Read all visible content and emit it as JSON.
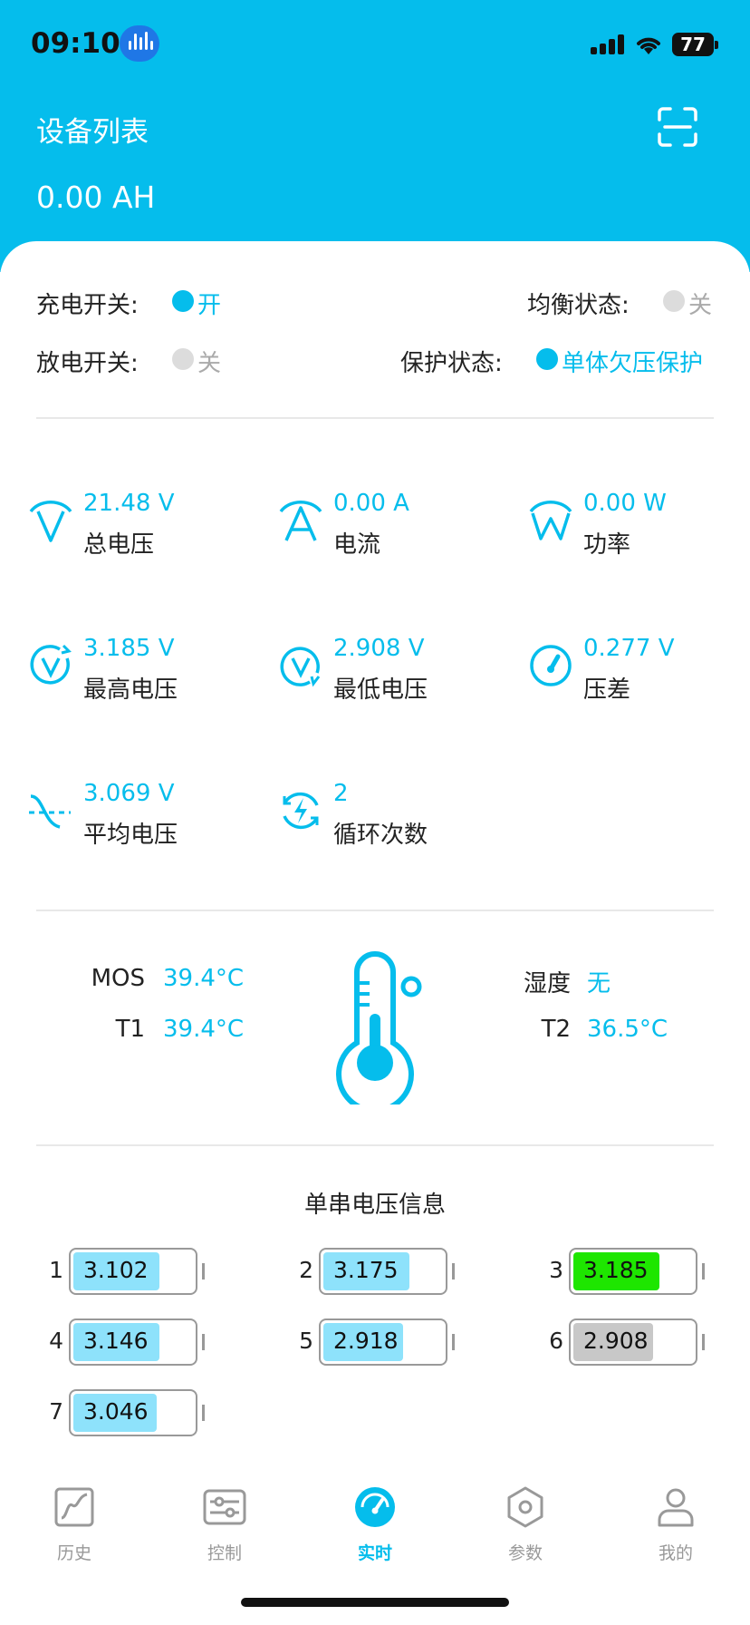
{
  "status_bar": {
    "time": "09:10",
    "battery": "77"
  },
  "header": {
    "title": "设备列表",
    "capacity": "0.00 AH"
  },
  "switches": {
    "charge_label": "充电开关:",
    "charge_state": "开",
    "balance_label": "均衡状态:",
    "balance_state": "关",
    "discharge_label": "放电开关:",
    "discharge_state": "关",
    "protect_label": "保护状态:",
    "protect_state": "单体欠压保护"
  },
  "metrics": [
    {
      "value": "21.48 V",
      "label": "总电压",
      "icon": "total-voltage-icon"
    },
    {
      "value": "0.00 A",
      "label": "电流",
      "icon": "current-icon"
    },
    {
      "value": "0.00 W",
      "label": "功率",
      "icon": "power-icon"
    },
    {
      "value": "3.185 V",
      "label": "最高电压",
      "icon": "max-voltage-icon"
    },
    {
      "value": "2.908 V",
      "label": "最低电压",
      "icon": "min-voltage-icon"
    },
    {
      "value": "0.277 V",
      "label": "压差",
      "icon": "gauge-icon"
    },
    {
      "value": "3.069 V",
      "label": "平均电压",
      "icon": "average-voltage-icon"
    },
    {
      "value": "2",
      "label": "循环次数",
      "icon": "cycle-icon"
    }
  ],
  "temperature": {
    "mos_label": "MOS",
    "mos_value": "39.4°C",
    "t1_label": "T1",
    "t1_value": "39.4°C",
    "humidity_label": "湿度",
    "humidity_value": "无",
    "t2_label": "T2",
    "t2_value": "36.5°C"
  },
  "cells": {
    "title": "单串电压信息",
    "items": [
      {
        "index": "1",
        "voltage": "3.102",
        "fill_fraction": 0.72,
        "color": "#8ee2fb"
      },
      {
        "index": "2",
        "voltage": "3.175",
        "fill_fraction": 0.72,
        "color": "#8ee2fb"
      },
      {
        "index": "3",
        "voltage": "3.185",
        "fill_fraction": 0.72,
        "color": "#1ee600"
      },
      {
        "index": "4",
        "voltage": "3.146",
        "fill_fraction": 0.72,
        "color": "#8ee2fb"
      },
      {
        "index": "5",
        "voltage": "2.918",
        "fill_fraction": 0.67,
        "color": "#8ee2fb"
      },
      {
        "index": "6",
        "voltage": "2.908",
        "fill_fraction": 0.67,
        "color": "#c8c8c8"
      },
      {
        "index": "7",
        "voltage": "3.046",
        "fill_fraction": 0.7,
        "color": "#8ee2fb"
      }
    ]
  },
  "tabs": [
    {
      "label": "历史",
      "icon": "history-chart-icon"
    },
    {
      "label": "控制",
      "icon": "sliders-icon"
    },
    {
      "label": "实时",
      "icon": "dashboard-icon",
      "active": true
    },
    {
      "label": "参数",
      "icon": "hex-nut-icon"
    },
    {
      "label": "我的",
      "icon": "user-icon"
    }
  ],
  "colors": {
    "accent": "#05bdec"
  }
}
